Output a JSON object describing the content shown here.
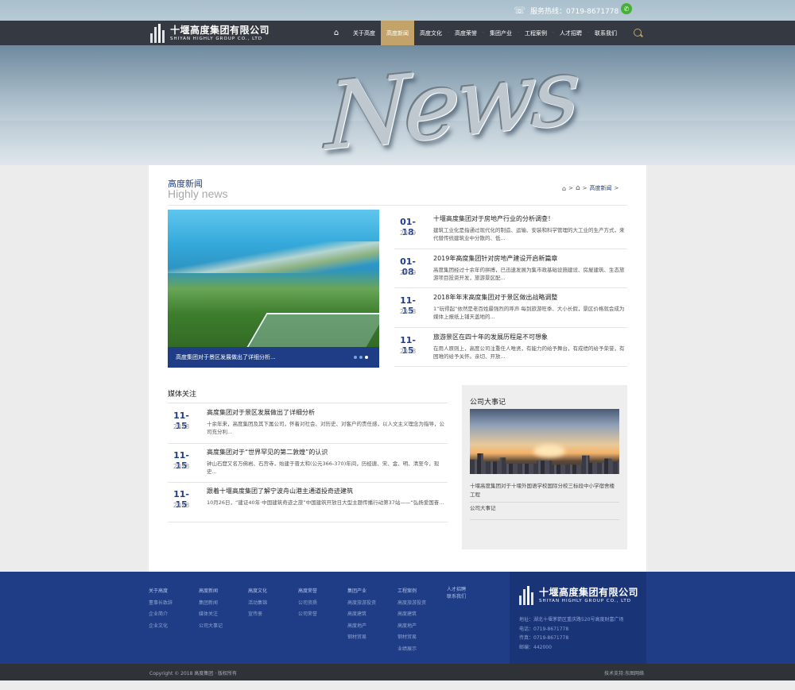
{
  "topbar": {
    "hotline": "服务热线：0719-8671778"
  },
  "brand": {
    "name_cn": "十堰高度集团有限公司",
    "name_en": "SHIYAN HIGHLY GROUP CO., LTD"
  },
  "nav": {
    "items": [
      "关于高度",
      "高度新闻",
      "高度文化",
      "高度荣誉",
      "集团产业",
      "工程案例",
      "人才招聘",
      "联系我们"
    ],
    "active": "高度新闻"
  },
  "banner": {
    "word": "News"
  },
  "section": {
    "title_cn": "高度新闻",
    "title_en": "Highly news"
  },
  "breadcrumb": {
    "sep1": ">",
    "sep2": ">",
    "current": "高度新闻",
    "sep3": ">"
  },
  "slide": {
    "caption": "高度集团对于景区发展做出了详细分析..."
  },
  "news": [
    {
      "md": "01-18",
      "year": "2019",
      "title": "十堰高度集团对于房地产行业的分析调查！",
      "desc": "建筑工业化是指通过现代化的制造、运输、安装和科学管理的大工业的生产方式，来代替传统建筑业中分散的、低..."
    },
    {
      "md": "01-08",
      "year": "2019",
      "title": "2019年高度集团针对房地产建设开启新篇章",
      "desc": "高度集团经过十余年的拼搏，已迅速发展为集市政基础设施建设、房屋建筑、生态旅游项目投资开发，旅游景区配..."
    },
    {
      "md": "11-15",
      "year": "2018",
      "title": "2018年年末高度集团对于景区做出战略调整",
      "desc": "1“玩得起”依然是老百姓最强烈的呼声 每到旅游旺季、大小长假，景区价格就会成为媒体上报纸上铺天盖地的..."
    },
    {
      "md": "11-15",
      "year": "2018",
      "title": "旅游景区在四十年的发展历程是不可想象",
      "desc": "在用人原则上，高度公司注重任人唯贤，有能力的给予舞台，有成绩的给予荣誉，有困难的给予关怀。亲切、开放..."
    }
  ],
  "media": {
    "title": "媒体关注",
    "items": [
      {
        "md": "11-15",
        "year": "2018",
        "title": "高度集团对于景区发展做出了详细分析",
        "desc": "十余年来，高度集团及其下属公司，怀着对社会、对历史、对客户的责任感，以人文主义理念为指导，公司充分利..."
      },
      {
        "md": "11-15",
        "year": "2018",
        "title": "高度集团对于“世界罕见的第二敦煌”的认识",
        "desc": "钟山石窟又名万佛岩、石宫寺，始建于晋太和(公元366-370)年间，历经唐、宋、金、明、清至今，现史..."
      },
      {
        "md": "11-15",
        "year": "2018",
        "title": "跟着十堰高度集团了解宁波舟山港主通道投奇迹建筑",
        "desc": "10月26日，“建证40年·中国建筑奇迹之旅”中国建筑开放日大型主题传播行动第37站——“弘扬爱国奋..."
      }
    ]
  },
  "events": {
    "title": "公司大事记",
    "items": [
      "十堰高度集团对于十堰外国语学校国际分校三标段中小学宿舍楼工程",
      "公司大事记"
    ]
  },
  "footer": {
    "columns": [
      {
        "head": "关于高度",
        "links": [
          "董事长致辞",
          "企业简介",
          "企业文化"
        ]
      },
      {
        "head": "高度新闻",
        "links": [
          "集团新闻",
          "媒体关注",
          "公司大事记"
        ]
      },
      {
        "head": "高度文化",
        "links": [
          "活动集锦",
          "宣传册"
        ]
      },
      {
        "head": "高度荣誉",
        "links": [
          "公司资质",
          "公司荣誉"
        ]
      },
      {
        "head": "集团产业",
        "links": [
          "高度旅游投资",
          "高度建筑",
          "高度地产",
          "钢材贸易"
        ]
      },
      {
        "head": "工程案例",
        "links": [
          "高度旅游投资",
          "高度建筑",
          "高度地产",
          "钢材贸易",
          "业绩展示"
        ]
      },
      {
        "head": "人才招聘",
        "links": [
          "联系我们"
        ]
      }
    ],
    "contact": {
      "address": "地址：湖北十堰茅箭区重庆路520号高度财富广场",
      "phone": "电话：0719-8671778",
      "fax": "传真：0719-8671778",
      "zip": "邮编：442000"
    },
    "copyright": "Copyright © 2018 高度集团 · 版权所有",
    "support": "技术支持:东图网络"
  }
}
